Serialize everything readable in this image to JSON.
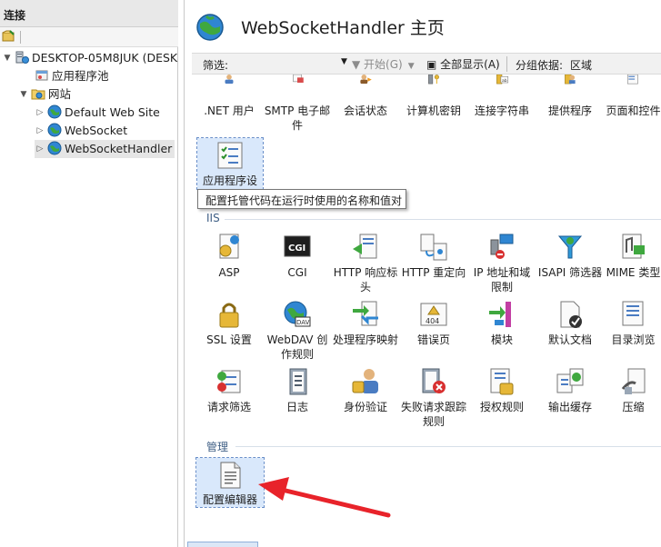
{
  "connections": {
    "header": "连接",
    "tree": [
      {
        "label": "DESKTOP-05M8JUK (DESK",
        "icon": "server-icon",
        "expander": "▼"
      },
      {
        "label": "应用程序池",
        "icon": "app-pool-icon",
        "expander": ""
      },
      {
        "label": "网站",
        "icon": "sites-folder-icon",
        "expander": "▼"
      },
      {
        "label": "Default Web Site",
        "icon": "globe-icon",
        "expander": "▷"
      },
      {
        "label": "WebSocket",
        "icon": "globe-icon",
        "expander": "▷"
      },
      {
        "label": "WebSocketHandler",
        "icon": "globe-icon",
        "expander": "▷"
      }
    ]
  },
  "main": {
    "title": "WebSocketHandler 主页",
    "filter": {
      "label": "筛选:",
      "value": "",
      "go_label": "开始(G)",
      "show_all_label": "全部显示(A)",
      "group_label": "分组依据:",
      "group_value": "区域"
    },
    "aspnet_features": [
      {
        "label": ".NET 用户",
        "icon": "dotnet-users-icon"
      },
      {
        "label": "SMTP 电子邮件",
        "icon": "smtp-email-icon"
      },
      {
        "label": "会话状态",
        "icon": "session-state-icon"
      },
      {
        "label": "计算机密钥",
        "icon": "machine-key-icon"
      },
      {
        "label": "连接字符串",
        "icon": "connection-strings-icon"
      },
      {
        "label": "提供程序",
        "icon": "providers-icon"
      },
      {
        "label": "页面和控件",
        "icon": "pages-controls-icon"
      },
      {
        "label": "应用程序设",
        "icon": "app-settings-icon"
      }
    ],
    "tooltip": "配置托管代码在运行时使用的名称和值对",
    "iis_group": {
      "title": "IIS",
      "features": [
        {
          "label": "ASP",
          "icon": "asp-icon"
        },
        {
          "label": "CGI",
          "icon": "cgi-icon"
        },
        {
          "label": "HTTP 响应标头",
          "icon": "http-headers-icon"
        },
        {
          "label": "HTTP 重定向",
          "icon": "http-redirect-icon"
        },
        {
          "label": "IP 地址和域限制",
          "icon": "ip-restrictions-icon"
        },
        {
          "label": "ISAPI 筛选器",
          "icon": "isapi-filters-icon"
        },
        {
          "label": "MIME 类型",
          "icon": "mime-types-icon"
        },
        {
          "label": "SSL 设置",
          "icon": "ssl-lock-icon"
        },
        {
          "label": "WebDAV 创作规则",
          "icon": "webdav-icon"
        },
        {
          "label": "处理程序映射",
          "icon": "handler-mappings-icon"
        },
        {
          "label": "错误页",
          "icon": "error-pages-icon"
        },
        {
          "label": "模块",
          "icon": "modules-icon"
        },
        {
          "label": "默认文档",
          "icon": "default-document-icon"
        },
        {
          "label": "目录浏览",
          "icon": "directory-browsing-icon"
        },
        {
          "label": "请求筛选",
          "icon": "request-filtering-icon"
        },
        {
          "label": "日志",
          "icon": "logging-icon"
        },
        {
          "label": "身份验证",
          "icon": "authentication-icon"
        },
        {
          "label": "失败请求跟踪规则",
          "icon": "failed-request-tracing-icon"
        },
        {
          "label": "授权规则",
          "icon": "authorization-rules-icon"
        },
        {
          "label": "输出缓存",
          "icon": "output-caching-icon"
        },
        {
          "label": "压缩",
          "icon": "compression-icon"
        }
      ]
    },
    "management_group": {
      "title": "管理",
      "features": [
        {
          "label": "配置编辑器",
          "icon": "configuration-editor-icon"
        }
      ]
    }
  },
  "colors": {
    "selection": "#d9e8fb",
    "group_title": "#3f5f85",
    "annotation_arrow": "#e8232a"
  }
}
